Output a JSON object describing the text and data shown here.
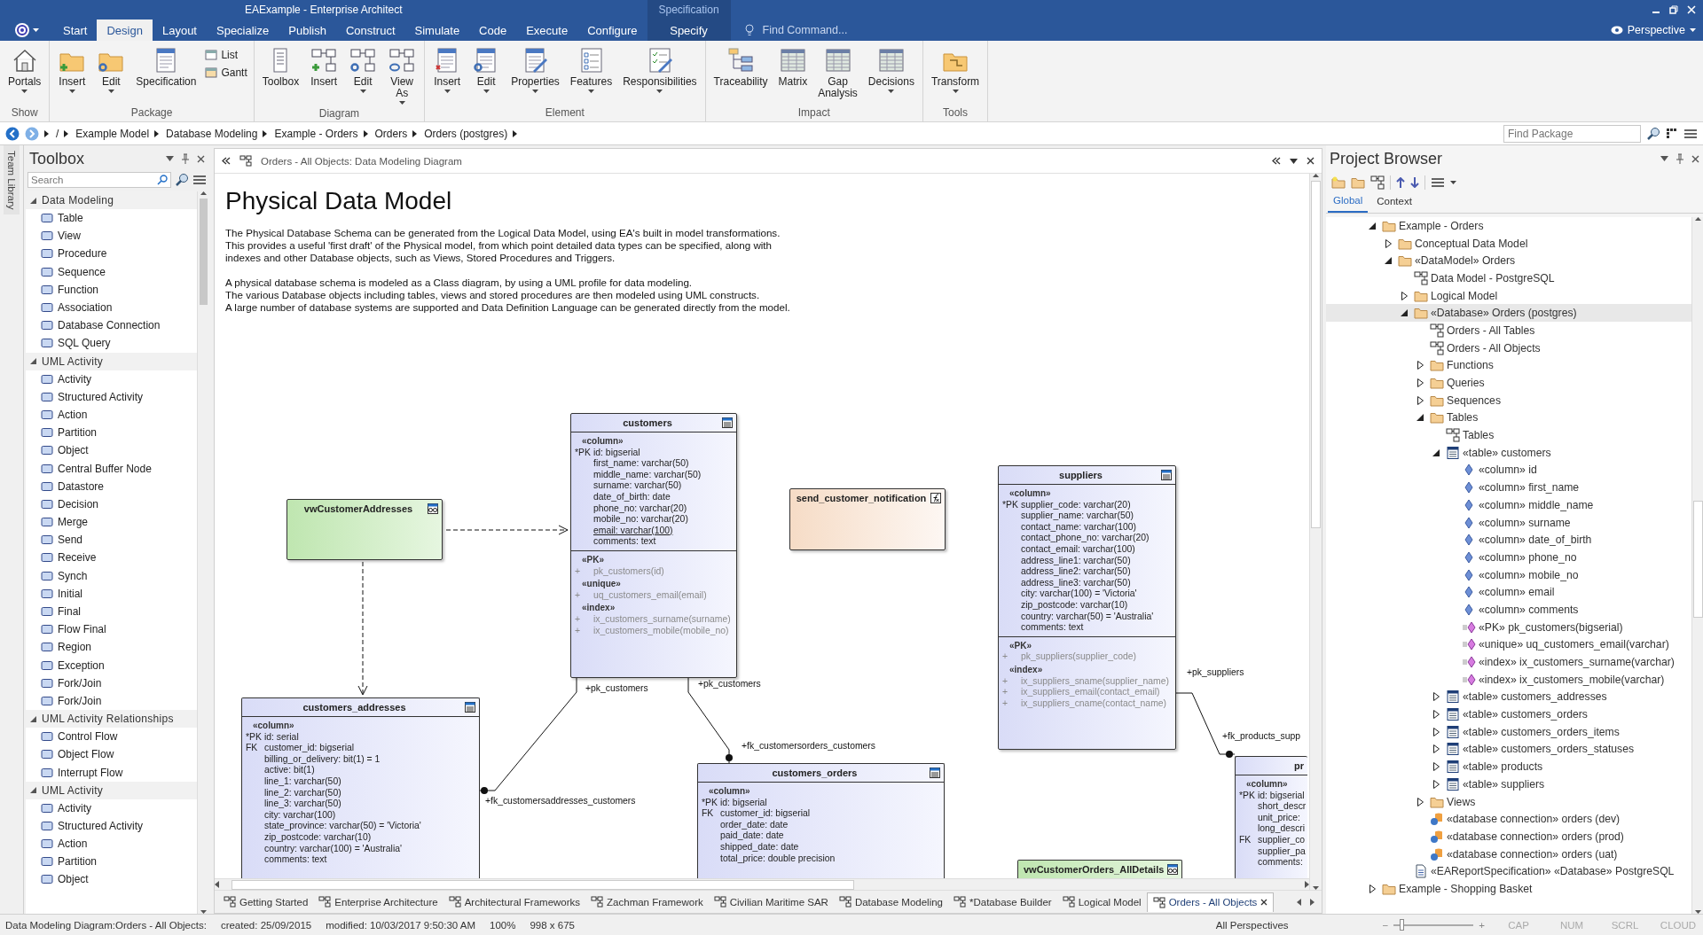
{
  "window": {
    "title": "EAExample - Enterprise Architect"
  },
  "ribbon_tabs": [
    {
      "label": "Start",
      "selected": false
    },
    {
      "label": "Design",
      "selected": true
    },
    {
      "label": "Layout",
      "selected": false
    },
    {
      "label": "Specialize",
      "selected": false
    },
    {
      "label": "Publish",
      "selected": false
    },
    {
      "label": "Construct",
      "selected": false
    },
    {
      "label": "Simulate",
      "selected": false
    },
    {
      "label": "Code",
      "selected": false
    },
    {
      "label": "Execute",
      "selected": false
    },
    {
      "label": "Configure",
      "selected": false
    }
  ],
  "contextual_group": {
    "label": "Specification",
    "tabs": [
      {
        "label": "Specify",
        "selected": false
      }
    ]
  },
  "find_command": {
    "placeholder": "Find Command..."
  },
  "perspective": {
    "label": "Perspective"
  },
  "ribbon_groups": [
    {
      "label": "Show",
      "buttons": [
        {
          "label": "Portals",
          "kind": "large",
          "dropdown": true
        }
      ]
    },
    {
      "label": "Package",
      "buttons": [
        {
          "label": "Insert",
          "kind": "large",
          "dropdown": true
        },
        {
          "label": "Edit",
          "kind": "large",
          "dropdown": true
        },
        {
          "label": "Specification",
          "kind": "large",
          "dropdown": false
        },
        {
          "label": "List",
          "kind": "small",
          "dropdown": false
        },
        {
          "label": "Gantt",
          "kind": "small",
          "dropdown": false
        }
      ]
    },
    {
      "label": "Diagram",
      "buttons": [
        {
          "label": "Toolbox",
          "kind": "large",
          "dropdown": false
        },
        {
          "label": "Insert",
          "kind": "large",
          "dropdown": false
        },
        {
          "label": "Edit",
          "kind": "large",
          "dropdown": true
        },
        {
          "label": "View As",
          "kind": "large",
          "dropdown": true
        }
      ]
    },
    {
      "label": "Element",
      "buttons": [
        {
          "label": "Insert",
          "kind": "large",
          "dropdown": true
        },
        {
          "label": "Edit",
          "kind": "large",
          "dropdown": true
        },
        {
          "label": "Properties",
          "kind": "large",
          "dropdown": true
        },
        {
          "label": "Features",
          "kind": "large",
          "dropdown": true
        },
        {
          "label": "Responsibilities",
          "kind": "large",
          "dropdown": true
        }
      ]
    },
    {
      "label": "Impact",
      "buttons": [
        {
          "label": "Traceability",
          "kind": "large",
          "dropdown": false
        },
        {
          "label": "Matrix",
          "kind": "large",
          "dropdown": false
        },
        {
          "label": "Gap Analysis",
          "kind": "large",
          "dropdown": false
        },
        {
          "label": "Decisions",
          "kind": "large",
          "dropdown": true
        }
      ]
    },
    {
      "label": "Tools",
      "buttons": [
        {
          "label": "Transform",
          "kind": "large",
          "dropdown": true
        }
      ]
    }
  ],
  "breadcrumb": [
    "/",
    "Example Model",
    "Database Modeling",
    "Example - Orders",
    "Orders",
    "Orders (postgres)"
  ],
  "find_package": {
    "placeholder": "Find Package"
  },
  "side_tab": "Team Library",
  "toolbox": {
    "title": "Toolbox",
    "search": {
      "placeholder": "Search"
    },
    "sections": [
      {
        "title": "Data Modeling",
        "expanded": true,
        "items": [
          "Table",
          "View",
          "Procedure",
          "Sequence",
          "Function",
          "Association",
          "Database Connection",
          "SQL Query"
        ]
      },
      {
        "title": "UML Activity",
        "expanded": true,
        "items": [
          "Activity",
          "Structured Activity",
          "Action",
          "Partition",
          "Object",
          "Central Buffer Node",
          "Datastore",
          "Decision",
          "Merge",
          "Send",
          "Receive",
          "Synch",
          "Initial",
          "Final",
          "Flow Final",
          "Region",
          "Exception",
          "Fork/Join",
          "Fork/Join"
        ]
      },
      {
        "title": "UML Activity Relationships",
        "expanded": true,
        "items": [
          "Control Flow",
          "Object Flow",
          "Interrupt Flow"
        ]
      },
      {
        "title": "UML Activity",
        "expanded": true,
        "items": [
          "Activity",
          "Structured Activity",
          "Action",
          "Partition",
          "Object"
        ]
      }
    ]
  },
  "diagram": {
    "caption": "Orders - All Objects:  Data Modeling Diagram",
    "heading": "Physical Data Model",
    "notes": [
      [
        "The Physical Database Schema can be generated from the Logical Data Model, using EA's built in model transformations.",
        "This provides a useful 'first draft' of the Physical model, from which point detailed data types can be specified, along with",
        "indexes and other Database objects, such as Views, Stored Procedures and Triggers."
      ],
      [
        "A physical database schema is modeled as a Class diagram, by using a UML profile for data modeling.",
        "The various Database objects including tables, views and stored procedures are then modeled using UML constructs.",
        "A large number of database systems are supported and Data Definition Language can be generated directly from the model."
      ]
    ],
    "elements": [
      {
        "name": "customers",
        "kind": "table",
        "column_stereotype": "«column»",
        "columns": [
          {
            "key": "*PK",
            "text": "id: bigserial",
            "unique": false
          },
          {
            "text": "first_name: varchar(50)",
            "unique": false
          },
          {
            "text": "middle_name: varchar(50)",
            "unique": false
          },
          {
            "text": "surname: varchar(50)",
            "unique": false
          },
          {
            "text": "date_of_birth: date",
            "unique": false
          },
          {
            "text": "phone_no: varchar(20)",
            "unique": false
          },
          {
            "text": "mobile_no: varchar(20)",
            "unique": false
          },
          {
            "text": "email: varchar(100)",
            "unique": true
          },
          {
            "text": "comments: text",
            "unique": false
          }
        ],
        "groups": [
          {
            "stereotype": "«PK»",
            "items": [
              {
                "prefix": "+",
                "text": "pk_customers(id)"
              }
            ]
          },
          {
            "stereotype": "«unique»",
            "items": [
              {
                "prefix": "+",
                "text": "uq_customers_email(email)"
              }
            ]
          },
          {
            "stereotype": "«index»",
            "items": [
              {
                "prefix": "+",
                "text": "ix_customers_surname(surname)"
              },
              {
                "prefix": "+",
                "text": "ix_customers_mobile(mobile_no)"
              }
            ]
          }
        ]
      },
      {
        "name": "vwCustomerAddresses",
        "kind": "view"
      },
      {
        "name": "send_customer_notification",
        "kind": "function"
      },
      {
        "name": "suppliers",
        "kind": "table",
        "column_stereotype": "«column»",
        "columns": [
          {
            "key": "*PK",
            "text": "supplier_code: varchar(20)"
          },
          {
            "text": "supplier_name: varchar(50)"
          },
          {
            "text": "contact_name: varchar(100)"
          },
          {
            "text": "contact_phone_no: varchar(20)"
          },
          {
            "text": "contact_email: varchar(100)"
          },
          {
            "text": "address_line1: varchar(50)"
          },
          {
            "text": "address_line2: varchar(50)"
          },
          {
            "text": "address_line3: varchar(50)"
          },
          {
            "text": "city: varchar(100) = 'Victoria'"
          },
          {
            "text": "zip_postcode: varchar(10)"
          },
          {
            "text": "country: varchar(50) = 'Australia'"
          },
          {
            "text": "comments: text"
          }
        ],
        "groups": [
          {
            "stereotype": "«PK»",
            "items": [
              {
                "prefix": "+",
                "text": "pk_suppliers(supplier_code)"
              }
            ]
          },
          {
            "stereotype": "«index»",
            "items": [
              {
                "prefix": "+",
                "text": "ix_suppliers_sname(supplier_name)"
              },
              {
                "prefix": "+",
                "text": "ix_suppliers_email(contact_email)"
              },
              {
                "prefix": "+",
                "text": "ix_suppliers_cname(contact_name)"
              }
            ]
          }
        ]
      },
      {
        "name": "customers_addresses",
        "kind": "table",
        "column_stereotype": "«column»",
        "columns": [
          {
            "key": "*PK",
            "text": "id: serial"
          },
          {
            "key": "FK",
            "text": "customer_id: bigserial"
          },
          {
            "text": "billing_or_delivery: bit(1) = 1"
          },
          {
            "text": "active: bit(1)"
          },
          {
            "text": "line_1: varchar(50)"
          },
          {
            "text": "line_2: varchar(50)"
          },
          {
            "text": "line_3: varchar(50)"
          },
          {
            "text": "city: varchar(100)"
          },
          {
            "text": "state_province: varchar(50) = 'Victoria'"
          },
          {
            "text": "zip_postcode: varchar(10)"
          },
          {
            "text": "country: varchar(100) = 'Australia'"
          },
          {
            "text": "comments: text"
          }
        ]
      },
      {
        "name": "customers_orders",
        "kind": "table",
        "column_stereotype": "«column»",
        "columns": [
          {
            "key": "*PK",
            "text": "id: bigserial"
          },
          {
            "key": "FK",
            "text": "customer_id: bigserial"
          },
          {
            "text": "order_date: date"
          },
          {
            "text": "paid_date: date"
          },
          {
            "text": "shipped_date: date"
          },
          {
            "text": "total_price: double precision"
          }
        ]
      },
      {
        "name": "vwCustomerOrders_AllDetails",
        "kind": "view"
      },
      {
        "name": "pr",
        "kind": "table",
        "column_stereotype": "«column»",
        "columns": [
          {
            "key": "*PK",
            "text": "id: bigserial"
          },
          {
            "text": "short_descr"
          },
          {
            "text": "unit_price:"
          },
          {
            "text": "long_descri"
          },
          {
            "key": "FK",
            "text": "supplier_co"
          },
          {
            "text": "supplier_pa"
          },
          {
            "text": "comments:"
          }
        ]
      }
    ],
    "connectors": [
      {
        "kind": "dependency"
      },
      {
        "kind": "dependency"
      },
      {
        "kind": "association",
        "source_role": "+pk_customers",
        "target_role": "+fk_customersaddresses_customers"
      },
      {
        "kind": "association",
        "source_role": "+pk_customers",
        "target_role": "+fk_customersorders_customers"
      },
      {
        "kind": "association",
        "source_role": "+pk_suppliers",
        "target_role": "+fk_products_supp"
      }
    ]
  },
  "diagram_tabs": [
    {
      "label": "Getting Started",
      "selected": false
    },
    {
      "label": "Enterprise Architecture",
      "selected": false
    },
    {
      "label": "Architectural Frameworks",
      "selected": false
    },
    {
      "label": "Zachman Framework",
      "selected": false
    },
    {
      "label": "Civilian Maritime SAR",
      "selected": false
    },
    {
      "label": "Database Modeling",
      "selected": false
    },
    {
      "label": "*Database Builder",
      "selected": false
    },
    {
      "label": "Logical Model",
      "selected": false
    },
    {
      "label": "Orders - All Objects",
      "selected": true
    }
  ],
  "project_browser": {
    "title": "Project Browser",
    "tabs": [
      {
        "label": "Global",
        "selected": true
      },
      {
        "label": "Context",
        "selected": false
      }
    ],
    "tree": [
      {
        "label": "Example - Orders",
        "kind": "folder",
        "expanded": true,
        "selected": false,
        "children": [
          {
            "label": "Conceptual Data Model",
            "kind": "folder",
            "expanded": false,
            "selected": false
          },
          {
            "label": "«DataModel» Orders",
            "kind": "folder",
            "expanded": true,
            "selected": false,
            "children": [
              {
                "label": "Data Model - PostgreSQL",
                "kind": "diagram",
                "selected": false
              },
              {
                "label": "Logical Model",
                "kind": "folder",
                "expanded": false,
                "selected": false
              },
              {
                "label": "«Database» Orders (postgres)",
                "kind": "folder",
                "expanded": true,
                "selected": true,
                "children": [
                  {
                    "label": "Orders - All Tables",
                    "kind": "diagram",
                    "selected": false
                  },
                  {
                    "label": "Orders - All Objects",
                    "kind": "diagram",
                    "selected": false
                  },
                  {
                    "label": "Functions",
                    "kind": "folder",
                    "expanded": false,
                    "selected": false
                  },
                  {
                    "label": "Queries",
                    "kind": "folder",
                    "expanded": false,
                    "selected": false
                  },
                  {
                    "label": "Sequences",
                    "kind": "folder",
                    "expanded": false,
                    "selected": false
                  },
                  {
                    "label": "Tables",
                    "kind": "folder",
                    "expanded": true,
                    "selected": false,
                    "children": [
                      {
                        "label": "Tables",
                        "kind": "diagram",
                        "selected": false
                      },
                      {
                        "label": "«table» customers",
                        "kind": "table",
                        "expanded": true,
                        "selected": false,
                        "children": [
                          {
                            "label": "«column» id",
                            "kind": "column",
                            "selected": false
                          },
                          {
                            "label": "«column» first_name",
                            "kind": "column",
                            "selected": false
                          },
                          {
                            "label": "«column» middle_name",
                            "kind": "column",
                            "selected": false
                          },
                          {
                            "label": "«column» surname",
                            "kind": "column",
                            "selected": false
                          },
                          {
                            "label": "«column» date_of_birth",
                            "kind": "column",
                            "selected": false
                          },
                          {
                            "label": "«column» phone_no",
                            "kind": "column",
                            "selected": false
                          },
                          {
                            "label": "«column» mobile_no",
                            "kind": "column",
                            "selected": false
                          },
                          {
                            "label": "«column» email",
                            "kind": "column",
                            "selected": false
                          },
                          {
                            "label": "«column» comments",
                            "kind": "column",
                            "selected": false
                          },
                          {
                            "label": "«PK» pk_customers(bigserial)",
                            "kind": "index",
                            "selected": false
                          },
                          {
                            "label": "«unique» uq_customers_email(varchar)",
                            "kind": "index",
                            "selected": false
                          },
                          {
                            "label": "«index» ix_customers_surname(varchar)",
                            "kind": "index",
                            "selected": false
                          },
                          {
                            "label": "«index» ix_customers_mobile(varchar)",
                            "kind": "index",
                            "selected": false
                          }
                        ]
                      },
                      {
                        "label": "«table» customers_addresses",
                        "kind": "table",
                        "expanded": false,
                        "selected": false
                      },
                      {
                        "label": "«table» customers_orders",
                        "kind": "table",
                        "expanded": false,
                        "selected": false
                      },
                      {
                        "label": "«table» customers_orders_items",
                        "kind": "table",
                        "expanded": false,
                        "selected": false
                      },
                      {
                        "label": "«table» customers_orders_statuses",
                        "kind": "table",
                        "expanded": false,
                        "selected": false
                      },
                      {
                        "label": "«table» products",
                        "kind": "table",
                        "expanded": false,
                        "selected": false
                      },
                      {
                        "label": "«table» suppliers",
                        "kind": "table",
                        "expanded": false,
                        "selected": false
                      }
                    ]
                  },
                  {
                    "label": "Views",
                    "kind": "folder",
                    "expanded": false,
                    "selected": false
                  },
                  {
                    "label": "«database connection» orders (dev)",
                    "kind": "connection",
                    "selected": false
                  },
                  {
                    "label": "«database connection» orders (prod)",
                    "kind": "connection",
                    "selected": false
                  },
                  {
                    "label": "«database connection» orders (uat)",
                    "kind": "connection",
                    "selected": false
                  }
                ]
              },
              {
                "label": "«EAReportSpecification» «Database» PostgreSQL",
                "kind": "report",
                "selected": false
              }
            ]
          }
        ]
      },
      {
        "label": "Example - Shopping Basket",
        "kind": "folder",
        "expanded": false,
        "selected": false
      }
    ]
  },
  "status_bar": {
    "segments": [
      "Data Modeling Diagram:Orders - All Objects:",
      "created: 25/09/2015",
      "modified: 10/03/2017 9:50:30 AM",
      "100%",
      "998 x 675"
    ],
    "perspectives": "All Perspectives",
    "zoom_out": "−",
    "zoom_in": "+",
    "zoom_slider": {
      "level": 0.08
    },
    "indicators": [
      "CAP",
      "NUM",
      "SCRL",
      "CLOUD"
    ]
  }
}
